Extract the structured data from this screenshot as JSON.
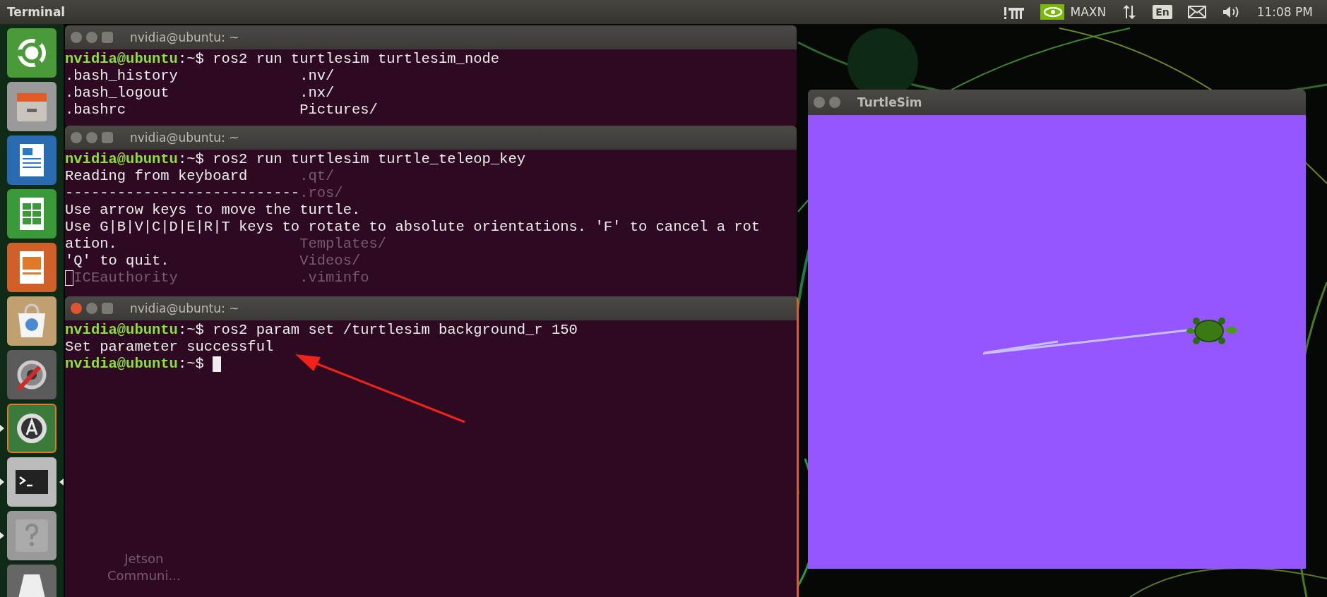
{
  "top_bar": {
    "app_title": "Terminal",
    "indicators": [
      {
        "kind": "network"
      },
      {
        "kind": "nvidia",
        "label": "MAXN"
      },
      {
        "kind": "transfer"
      },
      {
        "kind": "keyboard",
        "label": "En"
      },
      {
        "kind": "mail"
      },
      {
        "kind": "volume"
      }
    ],
    "clock": "11:08 PM"
  },
  "launcher": [
    {
      "kind": "dash",
      "running": false,
      "focused": false,
      "highlighted": false
    },
    {
      "kind": "files",
      "running": false,
      "focused": false,
      "highlighted": false
    },
    {
      "kind": "writer",
      "running": false,
      "focused": false,
      "highlighted": false
    },
    {
      "kind": "calc",
      "running": false,
      "focused": false,
      "highlighted": false
    },
    {
      "kind": "impress",
      "running": false,
      "focused": false,
      "highlighted": false
    },
    {
      "kind": "store",
      "running": false,
      "focused": false,
      "highlighted": false
    },
    {
      "kind": "settings",
      "running": false,
      "focused": false,
      "highlighted": false
    },
    {
      "kind": "updater",
      "running": true,
      "focused": false,
      "highlighted": true
    },
    {
      "kind": "terminal",
      "running": true,
      "focused": true,
      "highlighted": false
    },
    {
      "kind": "help",
      "running": true,
      "focused": false,
      "highlighted": false
    },
    {
      "kind": "drive",
      "running": false,
      "focused": false,
      "highlighted": false
    }
  ],
  "terminals": [
    {
      "title": "nvidia@ubuntu: ~",
      "focused": false,
      "lines": [
        {
          "kind": "prompt",
          "user": "nvidia@ubuntu",
          "rest": ":~$ ros2 run turtlesim turtlesim_node"
        },
        {
          "kind": "columns",
          "left": ".bash_history",
          "right": ".nv/"
        },
        {
          "kind": "columns",
          "left": ".bash_logout",
          "right": ".nx/"
        },
        {
          "kind": "columns",
          "left": ".bashrc",
          "right": "Pictures/"
        }
      ]
    },
    {
      "title": "nvidia@ubuntu: ~",
      "focused": false,
      "lines": [
        {
          "kind": "prompt",
          "user": "nvidia@ubuntu",
          "rest": ":~$ ros2 run turtlesim turtle_teleop_key"
        },
        {
          "kind": "text",
          "text": "Reading from keyboard"
        },
        {
          "kind": "text",
          "text": "---------------------------"
        },
        {
          "kind": "text",
          "text": "Use arrow keys to move the turtle."
        },
        {
          "kind": "text",
          "text": "Use G|B|V|C|D|E|R|T keys to rotate to absolute orientations. 'F' to cancel a rot"
        },
        {
          "kind": "text",
          "text": "ation."
        },
        {
          "kind": "text",
          "text": "'Q' to quit."
        },
        {
          "kind": "cursor"
        }
      ],
      "ghost_rows": [
        {},
        {
          "right": ".qt/"
        },
        {
          "right": ".ros/"
        },
        {},
        {},
        {
          "right": "Templates/"
        },
        {
          "right": "Videos/"
        },
        {
          "left": "ICEauthority",
          "right": ".viminfo"
        }
      ]
    },
    {
      "title": "nvidia@ubuntu: ~",
      "focused": true,
      "lines": [
        {
          "kind": "prompt",
          "user": "nvidia@ubuntu",
          "rest": ":~$ ros2 param set /turtlesim background_r 150"
        },
        {
          "kind": "text",
          "text": "Set parameter successful"
        },
        {
          "kind": "prompt",
          "user": "nvidia@ubuntu",
          "rest": ":~$ ",
          "cursor": true
        }
      ],
      "ghost_label": [
        "Jetson",
        "Communi..."
      ]
    }
  ],
  "turtlesim": {
    "title": "TurtleSim",
    "focused": false
  }
}
